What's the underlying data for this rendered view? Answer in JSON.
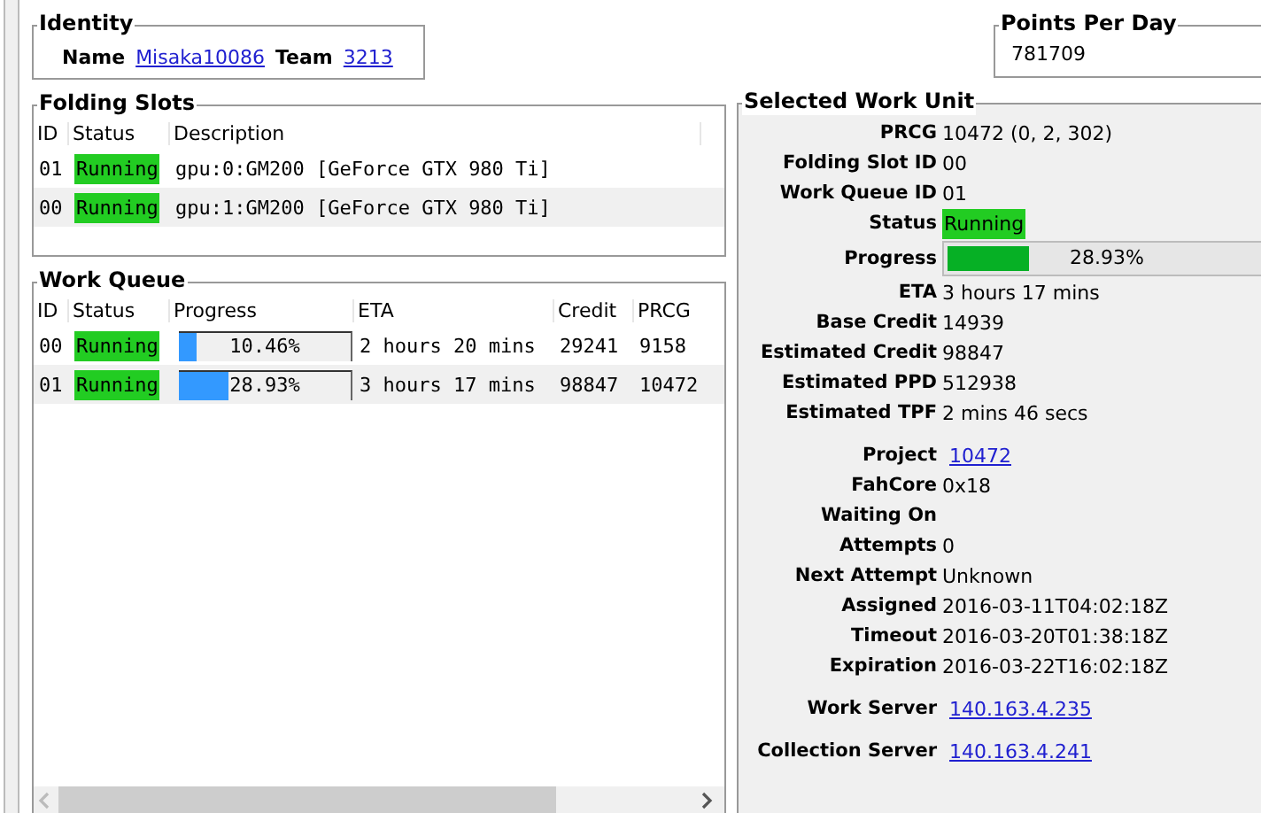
{
  "identity": {
    "title": "Identity",
    "name_label": "Name",
    "name": "Misaka10086",
    "team_label": "Team",
    "team": "3213"
  },
  "points_per_day": {
    "title": "Points Per Day",
    "value": "781709"
  },
  "folding_slots": {
    "title": "Folding Slots",
    "columns": [
      "ID",
      "Status",
      "Description"
    ],
    "rows": [
      {
        "id": "01",
        "status": "Running",
        "description": "gpu:0:GM200 [GeForce GTX 980 Ti]"
      },
      {
        "id": "00",
        "status": "Running",
        "description": "gpu:1:GM200 [GeForce GTX 980 Ti]"
      }
    ]
  },
  "work_queue": {
    "title": "Work Queue",
    "columns": [
      "ID",
      "Status",
      "Progress",
      "ETA",
      "Credit",
      "PRCG"
    ],
    "rows": [
      {
        "id": "00",
        "status": "Running",
        "level": 0.1046,
        "progress": "10.46%",
        "eta": "2 hours 20 mins",
        "credit": "29241",
        "prcg": "9158"
      },
      {
        "id": "01",
        "status": "Running",
        "level": 0.2893,
        "progress": "28.93%",
        "eta": "3 hours 17 mins",
        "credit": "98847",
        "prcg": "10472"
      }
    ]
  },
  "selected_work_unit": {
    "title": "Selected Work Unit",
    "fields": [
      {
        "kind": "text",
        "label": "PRCG",
        "value": "10472 (0, 2, 302)"
      },
      {
        "kind": "text",
        "label": "Folding Slot ID",
        "value": "00"
      },
      {
        "kind": "text",
        "label": "Work Queue ID",
        "value": "01"
      },
      {
        "kind": "status",
        "label": "Status",
        "value": "Running"
      },
      {
        "kind": "progress",
        "label": "Progress",
        "value": "28.93%",
        "level": 0.2893
      },
      {
        "kind": "text",
        "label": "ETA",
        "value": "3 hours 17 mins"
      },
      {
        "kind": "text",
        "label": "Base Credit",
        "value": "14939"
      },
      {
        "kind": "text",
        "label": "Estimated Credit",
        "value": "98847"
      },
      {
        "kind": "text",
        "label": "Estimated PPD",
        "value": "512938"
      },
      {
        "kind": "text",
        "label": "Estimated TPF",
        "value": "2 mins 46 secs"
      },
      {
        "kind": "link",
        "label": "Project",
        "value": "10472"
      },
      {
        "kind": "text",
        "label": "FahCore",
        "value": "0x18"
      },
      {
        "kind": "text",
        "label": "Waiting On"
      },
      {
        "kind": "text",
        "label": "Attempts",
        "value": "0"
      },
      {
        "kind": "text",
        "label": "Next Attempt",
        "value": "Unknown"
      },
      {
        "kind": "text",
        "label": "Assigned",
        "value": "2016-03-11T04:02:18Z"
      },
      {
        "kind": "text",
        "label": "Timeout",
        "value": "2016-03-20T01:38:18Z"
      },
      {
        "kind": "text",
        "label": "Expiration",
        "value": "2016-03-22T16:02:18Z"
      },
      {
        "kind": "link",
        "label": "Work Server",
        "value": "140.163.4.235"
      },
      {
        "kind": "link",
        "label": "Collection Server",
        "value": "140.163.4.241"
      }
    ]
  }
}
